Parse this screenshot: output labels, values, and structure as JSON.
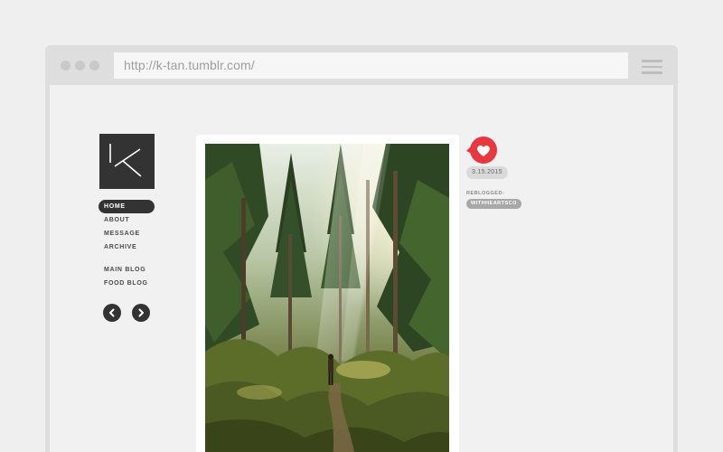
{
  "browser": {
    "url": "http://k-tan.tumblr.com/"
  },
  "sidebar": {
    "logo_icon": "k-logo-icon",
    "nav_primary": [
      "HOME",
      "ABOUT",
      "MESSAGE",
      "ARCHIVE"
    ],
    "nav_secondary": [
      "MAIN BLOG",
      "FOOD BLOG"
    ],
    "active_item": "HOME",
    "prev_icon": "chevron-left-icon",
    "next_icon": "chevron-right-icon"
  },
  "post": {
    "image_description_icon": "forest-photo",
    "like_icon": "heart-speech-bubble-icon",
    "date": "3.15.2015",
    "reblogged_label": "REBLOGGED:",
    "reblogged_from": "WITHHEARTSCO"
  },
  "colors": {
    "accent_red": "#e8373f",
    "dark": "#333333",
    "page_bg": "#efefef"
  }
}
